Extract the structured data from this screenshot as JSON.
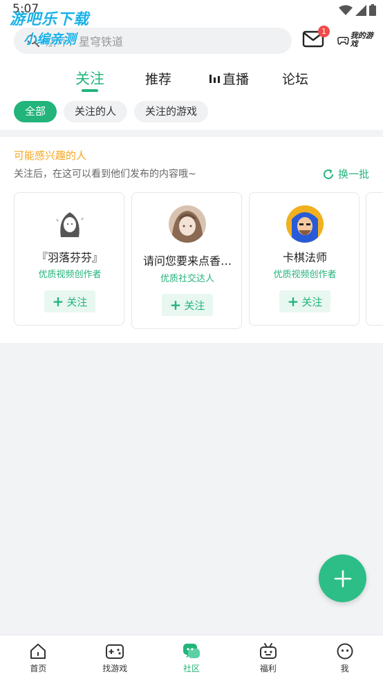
{
  "status_bar": {
    "time": "5:07"
  },
  "watermark": {
    "line1": "游吧乐下载",
    "line2": "小编亲测"
  },
  "header": {
    "search_placeholder": "崩坏：星穹铁道",
    "mail_badge": "1",
    "my_games": "我的游戏",
    "tabs": [
      {
        "label": "关注",
        "active": true
      },
      {
        "label": "推荐",
        "active": false
      },
      {
        "label": "直播",
        "active": false
      },
      {
        "label": "论坛",
        "active": false
      }
    ],
    "chips": [
      {
        "label": "全部",
        "active": true
      },
      {
        "label": "关注的人",
        "active": false
      },
      {
        "label": "关注的游戏",
        "active": false
      }
    ]
  },
  "recommend": {
    "title": "可能感兴趣的人",
    "subtitle": "关注后，在这可以看到他们发布的内容哦~",
    "refresh_label": "换一批",
    "follow_label": "关注",
    "users": [
      {
        "name": "『羽落芬芬』",
        "tag": "优质视频创作者"
      },
      {
        "name": "请问您要来点香…",
        "tag": "优质社交达人"
      },
      {
        "name": "卡棋法师",
        "tag": "优质视频创作者"
      }
    ]
  },
  "bottom_nav": [
    {
      "label": "首页",
      "icon": "home-icon",
      "active": false
    },
    {
      "label": "找游戏",
      "icon": "gamepad-icon",
      "active": false
    },
    {
      "label": "社区",
      "icon": "chat-bubble-icon",
      "active": true
    },
    {
      "label": "福利",
      "icon": "gift-icon",
      "active": false
    },
    {
      "label": "我",
      "icon": "smiley-icon",
      "active": false
    }
  ],
  "colors": {
    "accent": "#22b47a",
    "highlight": "#f5a623",
    "badge": "#f24a4a"
  }
}
